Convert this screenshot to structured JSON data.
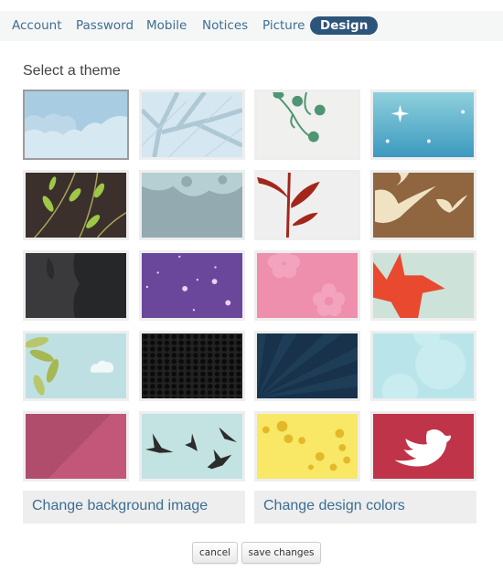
{
  "nav": {
    "tabs": [
      {
        "label": "Account"
      },
      {
        "label": "Password"
      },
      {
        "label": "Mobile"
      },
      {
        "label": "Notices"
      },
      {
        "label": "Picture"
      },
      {
        "label": "Design",
        "active": true
      }
    ]
  },
  "main": {
    "heading": "Select a theme",
    "selected_theme": "sky-clouds",
    "themes": [
      {
        "name": "sky-clouds",
        "color": "#a9cfe3"
      },
      {
        "name": "bare-tree",
        "color": "#d4e6ef"
      },
      {
        "name": "green-vines",
        "color": "#f0f0ee"
      },
      {
        "name": "blue-sparkles",
        "color": "#4ea9c9"
      },
      {
        "name": "brown-leaves",
        "color": "#3b302c"
      },
      {
        "name": "gray-foliage",
        "color": "#97aeb3"
      },
      {
        "name": "red-plant",
        "color": "#efefef"
      },
      {
        "name": "brown-birds",
        "color": "#8f6640"
      },
      {
        "name": "dark-texture",
        "color": "#333436"
      },
      {
        "name": "purple-stars",
        "color": "#6a479b"
      },
      {
        "name": "pink-flowers",
        "color": "#ee8fad"
      },
      {
        "name": "red-maple-leaf",
        "color": "#cde2d9"
      },
      {
        "name": "leaves-cloud",
        "color": "#bfe0e2"
      },
      {
        "name": "black-hexagons",
        "color": "#151515"
      },
      {
        "name": "navy-rays",
        "color": "#17324a"
      },
      {
        "name": "light-blue-bokeh",
        "color": "#b9e5ea"
      },
      {
        "name": "raspberry-diagonal",
        "color": "#c25675"
      },
      {
        "name": "flying-birds",
        "color": "#c2e3e1"
      },
      {
        "name": "yellow-leaves",
        "color": "#f9e766"
      },
      {
        "name": "twitter-bird",
        "color": "#bf3448"
      }
    ],
    "change_background_label": "Change background image",
    "change_colors_label": "Change design colors"
  },
  "actions": {
    "cancel_label": "cancel",
    "save_label": "save changes"
  }
}
